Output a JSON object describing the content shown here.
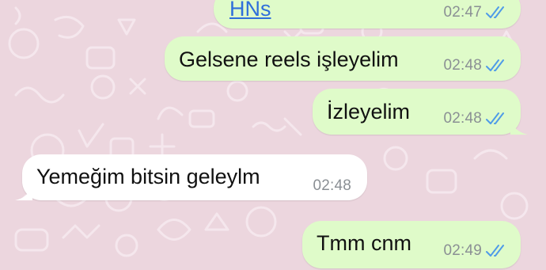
{
  "colors": {
    "wallpaper": "#ecd6de",
    "outgoing_bubble": "#dffbc9",
    "incoming_bubble": "#ffffff",
    "read_ticks": "#4f9be8",
    "link": "#2f6fdb"
  },
  "messages": [
    {
      "id": "m1",
      "direction": "outgoing",
      "text": "HNs",
      "is_link": true,
      "time": "02:47",
      "status_icon": "double-check-read-icon"
    },
    {
      "id": "m2",
      "direction": "outgoing",
      "text": "Gelsene reels işleyelim",
      "is_link": false,
      "time": "02:48",
      "status_icon": "double-check-read-icon"
    },
    {
      "id": "m3",
      "direction": "outgoing",
      "text": "İzleyelim",
      "is_link": false,
      "time": "02:48",
      "status_icon": "double-check-read-icon"
    },
    {
      "id": "m4",
      "direction": "incoming",
      "text": "Yemeğim bitsin geleylm",
      "is_link": false,
      "time": "02:48"
    },
    {
      "id": "m5",
      "direction": "outgoing",
      "text": "Tmm cnm",
      "is_link": false,
      "time": "02:49",
      "status_icon": "double-check-read-icon"
    }
  ]
}
